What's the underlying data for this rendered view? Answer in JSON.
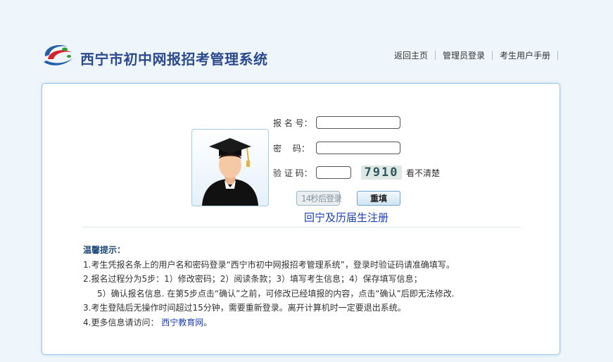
{
  "header": {
    "title": "西宁市初中网报招考管理系统",
    "nav": [
      "返回主页",
      "管理员登录",
      "考生用户手册"
    ]
  },
  "form": {
    "reg_no_label": "报 名 号：",
    "password_label": "密　  码：",
    "captcha_label": "验 证 码：",
    "reg_no_value": "",
    "password_value": "",
    "captcha_value": "",
    "captcha_image_text": "7910",
    "refresh_text": "看不清楚",
    "login_button": "14秒后登录",
    "reset_button": "重填",
    "register_link": "回宁及历届生注册"
  },
  "tips": {
    "title": "温馨提示：",
    "line1": "1.考生凭报名条上的用户名和密码登录“西宁市初中网报招考管理系统”，登录时验证码请准确填写。",
    "line2": "2.报名过程分为5步：1）修改密码；2）阅读条款；3）填写考生信息；4）保存填写信息；",
    "line2b": "5）确认报名信息. 在第5步点击“确认”之前，可修改已经填报的内容，点击“确认”后即无法修改.",
    "line3": "3.考生登陆后无操作时间超过15分钟，需要重新登录。离开计算机时一定要退出系统。",
    "line4_prefix": "4.更多信息请访问：",
    "line4_link": "西宁教育网",
    "line4_suffix": "。"
  },
  "colors": {
    "title": "#2b4a8f",
    "link": "#1c3fb8",
    "panel_border": "#9cc9e6",
    "background": "#eef6fb"
  },
  "icons": {
    "logo": "swirl-logo-icon",
    "avatar": "graduate-avatar-icon"
  }
}
